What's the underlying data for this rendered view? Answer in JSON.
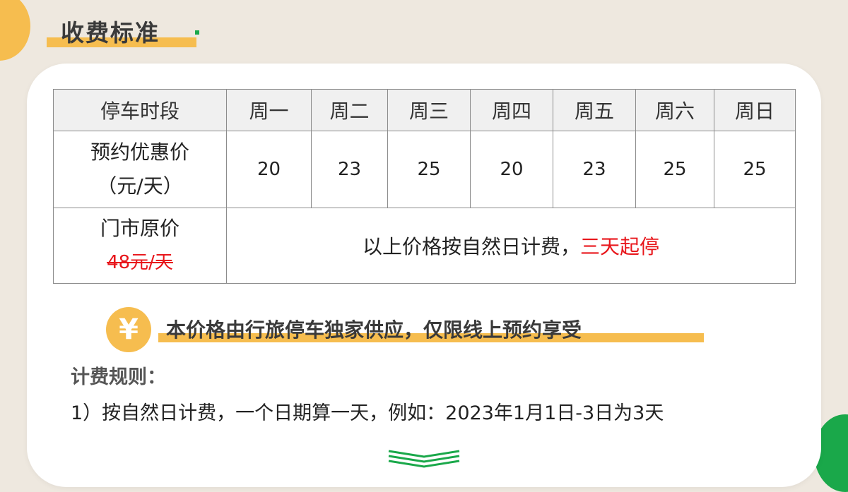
{
  "page": {
    "title": "收费标准"
  },
  "table": {
    "header": [
      "停车时段",
      "周一",
      "周二",
      "周三",
      "周四",
      "周五",
      "周六",
      "周日"
    ],
    "reserve_row": {
      "label_line1": "预约优惠价",
      "label_line2": "（元/天）",
      "prices": [
        "20",
        "23",
        "25",
        "20",
        "23",
        "25",
        "25"
      ]
    },
    "door_row": {
      "label_line1": "门市原价",
      "label_line2": "48元/天",
      "note_text": "以上价格按自然日计费，",
      "note_highlight": "三天起停"
    }
  },
  "yen_icon": "¥",
  "subtitle": "本价格由行旅停车独家供应，仅限线上预约享受",
  "rules": {
    "heading": "计费规则：",
    "line1": "1）按自然日计费，一个日期算一天，例如：2023年1月1日-3日为3天"
  },
  "colors": {
    "accent_yellow": "#f6bd4f",
    "accent_green": "#1aa84a",
    "highlight_red": "#e8161b",
    "background": "#eee8df"
  }
}
